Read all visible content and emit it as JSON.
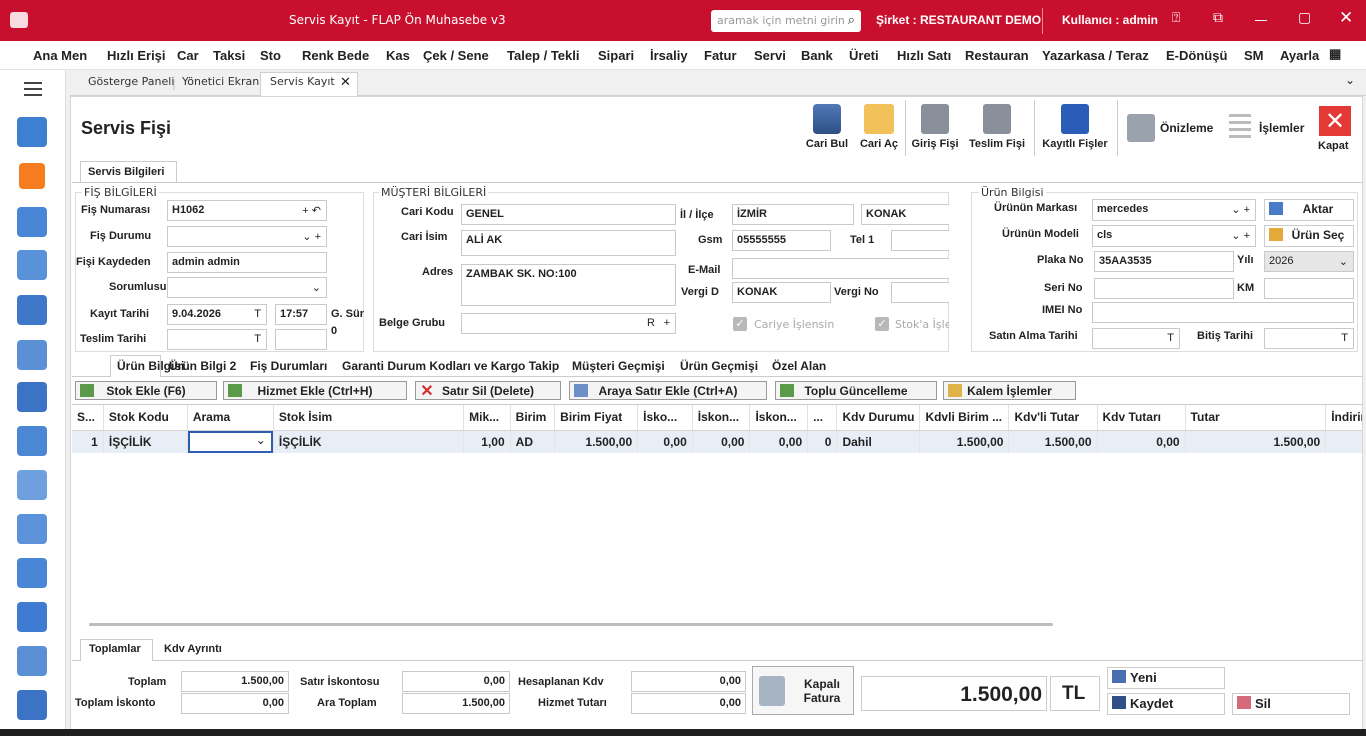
{
  "titlebar": {
    "title": "Servis Kayıt - FLAP Ön Muhasebe v3",
    "search_placeholder": "aramak için metni girin",
    "company": "Şirket : RESTAURANT DEMO",
    "user": "Kullanıcı : admin"
  },
  "menu": [
    "Ana Men",
    "Hızlı Erişi",
    "Car",
    "Taksi",
    "Sto",
    "Renk Bede",
    "Kas",
    "Çek / Sene",
    "Talep / Tekli",
    "Sipari",
    "İrsaliy",
    "Fatur",
    "Servi",
    "Bank",
    "Üreti",
    "Hızlı Satı",
    "Restauran",
    "Yazarkasa / Teraz",
    "E-Dönüşü",
    "SM",
    "Ayarla"
  ],
  "doc_tabs": [
    "Gösterge Paneli",
    "Yönetici Ekranı",
    "Servis Kayıt"
  ],
  "page_title": "Servis Fişi",
  "toolbar": {
    "cari_bul": "Cari Bul",
    "cari_ac": "Cari Aç",
    "giris_fisi": "Giriş Fişi",
    "teslim_fisi": "Teslim Fişi",
    "kayitli_fisler": "Kayıtlı Fişler",
    "onizleme": "Önizleme",
    "islemler": "İşlemler",
    "kapat": "Kapat"
  },
  "info_tab": "Servis Bilgileri",
  "fis": {
    "group": "FİŞ BİLGİLERİ",
    "fis_no_label": "Fiş Numarası",
    "fis_no": "H1062",
    "durum_label": "Fiş Durumu",
    "durum": "",
    "kaydeden_label": "Fişi Kaydeden",
    "kaydeden": "admin admin",
    "sorumlu_label": "Sorumlusu",
    "sorumlu": "",
    "kayit_tarihi_label": "Kayıt Tarihi",
    "kayit_tarihi": "9.04.2026",
    "saat": "17:57",
    "gsur_label": "G. Sür",
    "gsur": "0",
    "teslim_label": "Teslim Tarihi",
    "teslim": ""
  },
  "musteri": {
    "group": "MÜŞTERİ BİLGİLERİ",
    "cari_kodu_label": "Cari Kodu",
    "cari_kodu": "GENEL",
    "cari_isim_label": "Cari İsim",
    "cari_isim": "ALİ AK",
    "adres_label": "Adres",
    "adres": "ZAMBAK SK. NO:100",
    "belge_label": "Belge Grubu",
    "belge": "R",
    "il_label": "İl / İlçe",
    "il": "İZMİR",
    "ilce": "KONAK",
    "gsm_label": "Gsm",
    "gsm": "05555555",
    "tel1_label": "Tel 1",
    "tel1": "",
    "email_label": "E-Mail",
    "email": "",
    "vergid_label": "Vergi D",
    "vergid": "KONAK",
    "vergino_label": "Vergi No",
    "vergino": "",
    "cariye_label": "Cariye İşlensin",
    "stoka_label": "Stok'a İşle"
  },
  "urun": {
    "group": "Ürün Bilgisi",
    "marka_label": "Ürünün Markası",
    "marka": "mercedes",
    "model_label": "Ürünün Modeli",
    "model": "cls",
    "plaka_label": "Plaka No",
    "plaka": "35AA3535",
    "yil_label": "Yılı",
    "yil": "2026",
    "seri_label": "Seri No",
    "km_label": "KM",
    "imei_label": "IMEI No",
    "satin_label": "Satın Alma Tarihi",
    "bitis_label": "Bitiş Tarihi",
    "aktar": "Aktar",
    "urun_sec": "Ürün Seç"
  },
  "product_tabs": [
    "Ürün Bilgisi",
    "Ürün Bilgi 2",
    "Fiş Durumları",
    "Garanti Durum Kodları ve Kargo Takip",
    "Müşteri Geçmişi",
    "Ürün Geçmişi",
    "Özel Alan"
  ],
  "grid_buttons": [
    "Stok Ekle (F6)",
    "Hizmet Ekle (Ctrl+H)",
    "Satır Sil (Delete)",
    "Araya Satır Ekle (Ctrl+A)",
    "Toplu Güncelleme",
    "Kalem İşlemler"
  ],
  "grid": {
    "headers": [
      "S...",
      "Stok Kodu",
      "Arama",
      "Stok İsim",
      "Mik...",
      "Birim",
      "Birim Fiyat",
      "İsko...",
      "İskon...",
      "İskon...",
      "...",
      "Kdv Durumu",
      "Kdvli Birim ...",
      "Kdv'li Tutar",
      "Kdv Tutarı",
      "Tutar",
      "İndirim"
    ],
    "row": [
      "1",
      "İŞÇİLİK",
      "",
      "İŞÇİLİK",
      "1,00",
      "AD",
      "1.500,00",
      "0,00",
      "0,00",
      "0,00",
      "0",
      "Dahil",
      "1.500,00",
      "1.500,00",
      "0,00",
      "1.500,00",
      ""
    ]
  },
  "bottom_tabs": [
    "Toplamlar",
    "Kdv Ayrıntı"
  ],
  "totals": {
    "toplam_label": "Toplam",
    "toplam": "1.500,00",
    "toplam_isk_label": "Toplam İskonto",
    "toplam_isk": "0,00",
    "satir_isk_label": "Satır İskontosu",
    "satir_isk": "0,00",
    "ara_toplam_label": "Ara Toplam",
    "ara_toplam": "1.500,00",
    "hes_kdv_label": "Hesaplanan Kdv",
    "hes_kdv": "0,00",
    "hizmet_label": "Hizmet Tutarı",
    "hizmet": "0,00",
    "kapali_fatura": "Kapalı Fatura",
    "grand_total": "1.500,00",
    "currency": "TL",
    "yeni": "Yeni",
    "kaydet": "Kaydet",
    "sil": "Sil"
  },
  "colors": {
    "title_bar": "#c8102e",
    "close_red": "#e53935",
    "grid_row": "#e8eef6"
  }
}
